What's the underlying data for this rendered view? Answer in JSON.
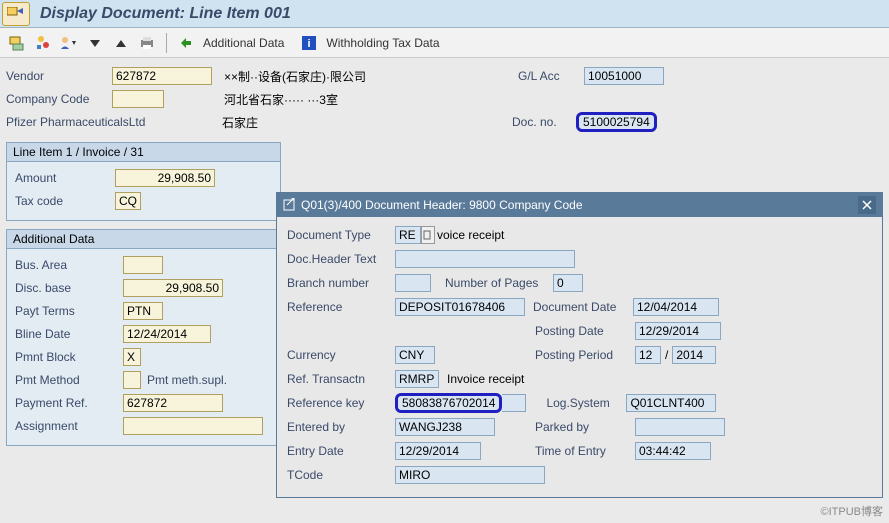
{
  "title": "Display Document: Line Item 001",
  "toolbar": {
    "additional_data": "Additional Data",
    "withholding_tax": "Withholding Tax Data"
  },
  "header": {
    "vendor_lbl": "Vendor",
    "vendor": "627872",
    "vendor_desc1": "××制··设备(石家庄)·限公司",
    "gl_acc_lbl": "G/L Acc",
    "gl_acc": "10051000",
    "company_code_lbl": "Company Code",
    "company_code": "",
    "company_desc": "河北省石家·····   ···3室",
    "pfizer": "Pfizer PharmaceuticalsLtd",
    "city": "石家庄",
    "doc_no_lbl": "Doc. no.",
    "doc_no": "5100025794"
  },
  "line_item": {
    "tab": "Line Item 1 / Invoice / 31",
    "amount_lbl": "Amount",
    "amount": "29,908.50",
    "tax_code_lbl": "Tax code",
    "tax_code": "CQ"
  },
  "additional": {
    "title": "Additional Data",
    "bus_area_lbl": "Bus. Area",
    "bus_area": "",
    "disc_base_lbl": "Disc. base",
    "disc_base": "29,908.50",
    "payt_terms_lbl": "Payt Terms",
    "payt_terms": "PTN",
    "bline_date_lbl": "Bline Date",
    "bline_date": "12/24/2014",
    "pmnt_block_lbl": "Pmnt Block",
    "pmnt_block": "X",
    "pmt_method_lbl": "Pmt Method",
    "pmt_method": "",
    "pmt_supl": "Pmt meth.supl.",
    "payment_ref_lbl": "Payment Ref.",
    "payment_ref": "627872",
    "assignment_lbl": "Assignment",
    "assignment": ""
  },
  "dialog": {
    "title": "Q01(3)/400 Document Header: 9800 Company Code",
    "doc_type_lbl": "Document Type",
    "doc_type": "RE",
    "doc_type_desc": "voice receipt",
    "doc_header_lbl": "Doc.Header Text",
    "doc_header": "",
    "branch_lbl": "Branch number",
    "branch": "",
    "pages_lbl": "Number of Pages",
    "pages": "0",
    "reference_lbl": "Reference",
    "reference": "DEPOSIT01678406",
    "doc_date_lbl": "Document Date",
    "doc_date": "12/04/2014",
    "posting_date_lbl": "Posting Date",
    "posting_date": "12/29/2014",
    "currency_lbl": "Currency",
    "currency": "CNY",
    "posting_period_lbl": "Posting Period",
    "posting_period_m": "12",
    "posting_period_sep": "/",
    "posting_period_y": "2014",
    "ref_trans_lbl": "Ref. Transactn",
    "ref_trans": "RMRP",
    "ref_trans_desc": "Invoice receipt",
    "ref_key_lbl": "Reference key",
    "ref_key": "58083876702014",
    "log_sys_lbl": "Log.System",
    "log_sys": "Q01CLNT400",
    "entered_by_lbl": "Entered by",
    "entered_by": "WANGJ238",
    "parked_by_lbl": "Parked by",
    "parked_by": "",
    "entry_date_lbl": "Entry Date",
    "entry_date": "12/29/2014",
    "entry_time_lbl": "Time of Entry",
    "entry_time": "03:44:42",
    "tcode_lbl": "TCode",
    "tcode": "MIRO"
  },
  "watermark": "©ITPUB博客"
}
